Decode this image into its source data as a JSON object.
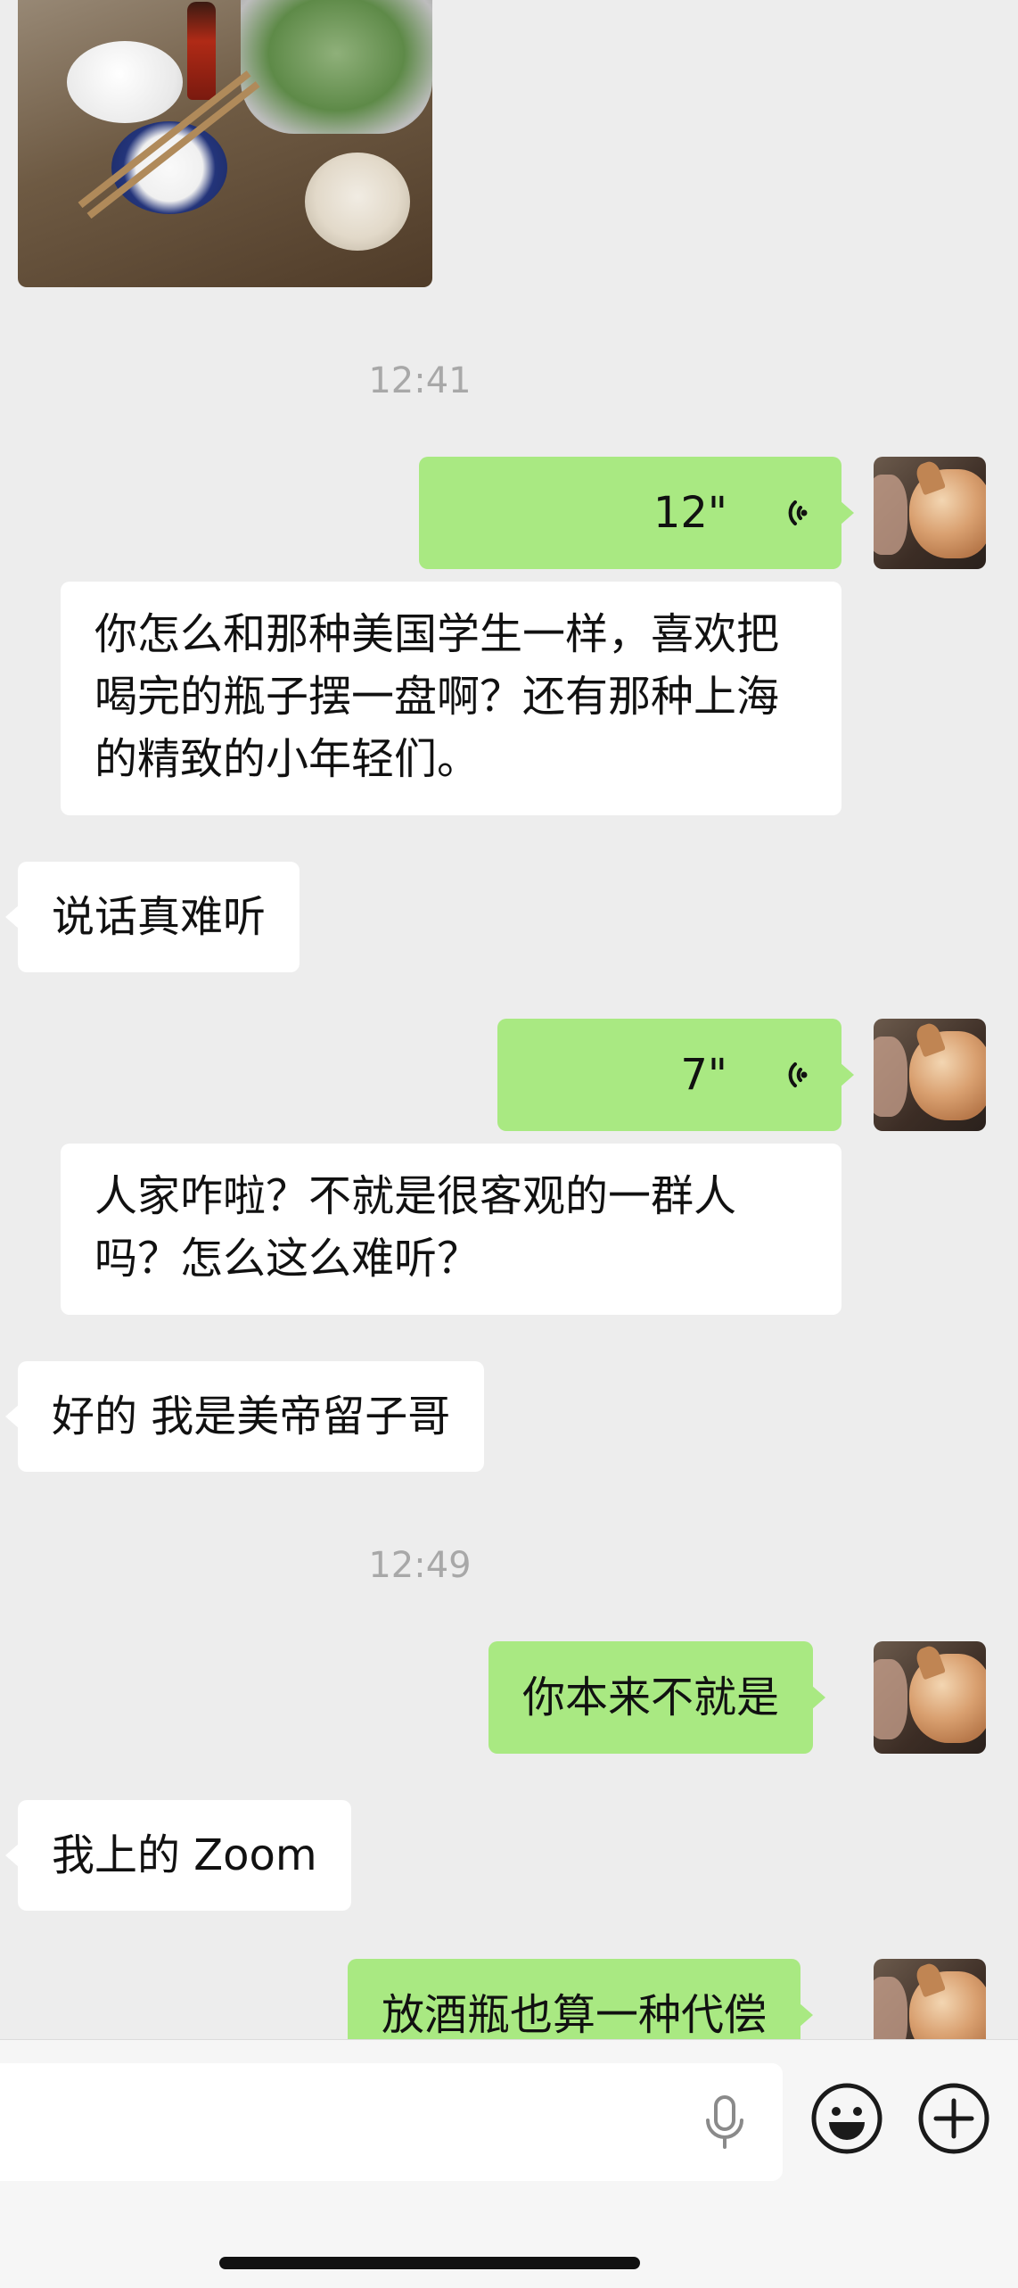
{
  "timestamps": {
    "t1": "12:41",
    "t2": "12:49"
  },
  "messages": {
    "voice1": {
      "duration": "12\"",
      "transcript": "你怎么和那种美国学生一样，喜欢把喝完的瓶子摆一盘啊？还有那种上海的精致的小年轻们。"
    },
    "text1": "说话真难听",
    "voice2": {
      "duration": "7\"",
      "transcript": "人家咋啦？不就是很客观的一群人吗？怎么这么难听？"
    },
    "text2": "好的 我是美帝留子哥",
    "text3": "你本来不就是",
    "text4": "我上的 Zoom",
    "text5": "放酒瓶也算一种代偿"
  },
  "icons": {
    "voice": "voice-wave-icon",
    "mic": "microphone-icon",
    "emoji": "emoji-icon",
    "plus": "plus-icon"
  },
  "colors": {
    "sent_bubble": "#a9e982",
    "received_bubble": "#ffffff",
    "background": "#ededed"
  }
}
